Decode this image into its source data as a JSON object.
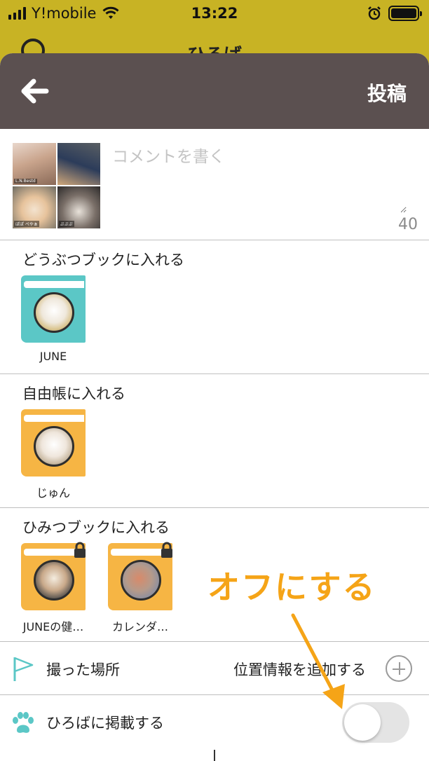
{
  "status_bar": {
    "carrier": "Y!mobile",
    "time": "13:22"
  },
  "background_app": {
    "title": "ひろば"
  },
  "nav": {
    "back_icon": "arrow-left-icon",
    "post_label": "投稿"
  },
  "comment": {
    "placeholder": "コメントを書く",
    "char_count": "40"
  },
  "thumbnails": [
    {
      "tag": "L.N.Bestd"
    },
    {
      "tag": ""
    },
    {
      "tag": "ぽぽ ぺやぁ"
    },
    {
      "tag": "ぷぷぷ"
    }
  ],
  "sections": {
    "animal_book": {
      "title": "どうぶつブックに入れる",
      "books": [
        {
          "label": "JUNE",
          "color": "#5bc7c6"
        }
      ]
    },
    "free_book": {
      "title": "自由帳に入れる",
      "books": [
        {
          "label": "じゅん",
          "color": "#f6b544"
        }
      ]
    },
    "secret_book": {
      "title": "ひみつブックに入れる",
      "books": [
        {
          "label": "JUNEの健…",
          "color": "#f6b544"
        },
        {
          "label": "カレンダ…",
          "color": "#f6b544"
        }
      ]
    }
  },
  "location_row": {
    "label": "撮った場所",
    "action": "位置情報を追加する",
    "icon": "flag-icon"
  },
  "plaza_row": {
    "label": "ひろばに掲載する",
    "icon": "paw-icon",
    "toggle_on": false
  },
  "annotation": {
    "text": "オフにする",
    "color": "#f5a417"
  }
}
